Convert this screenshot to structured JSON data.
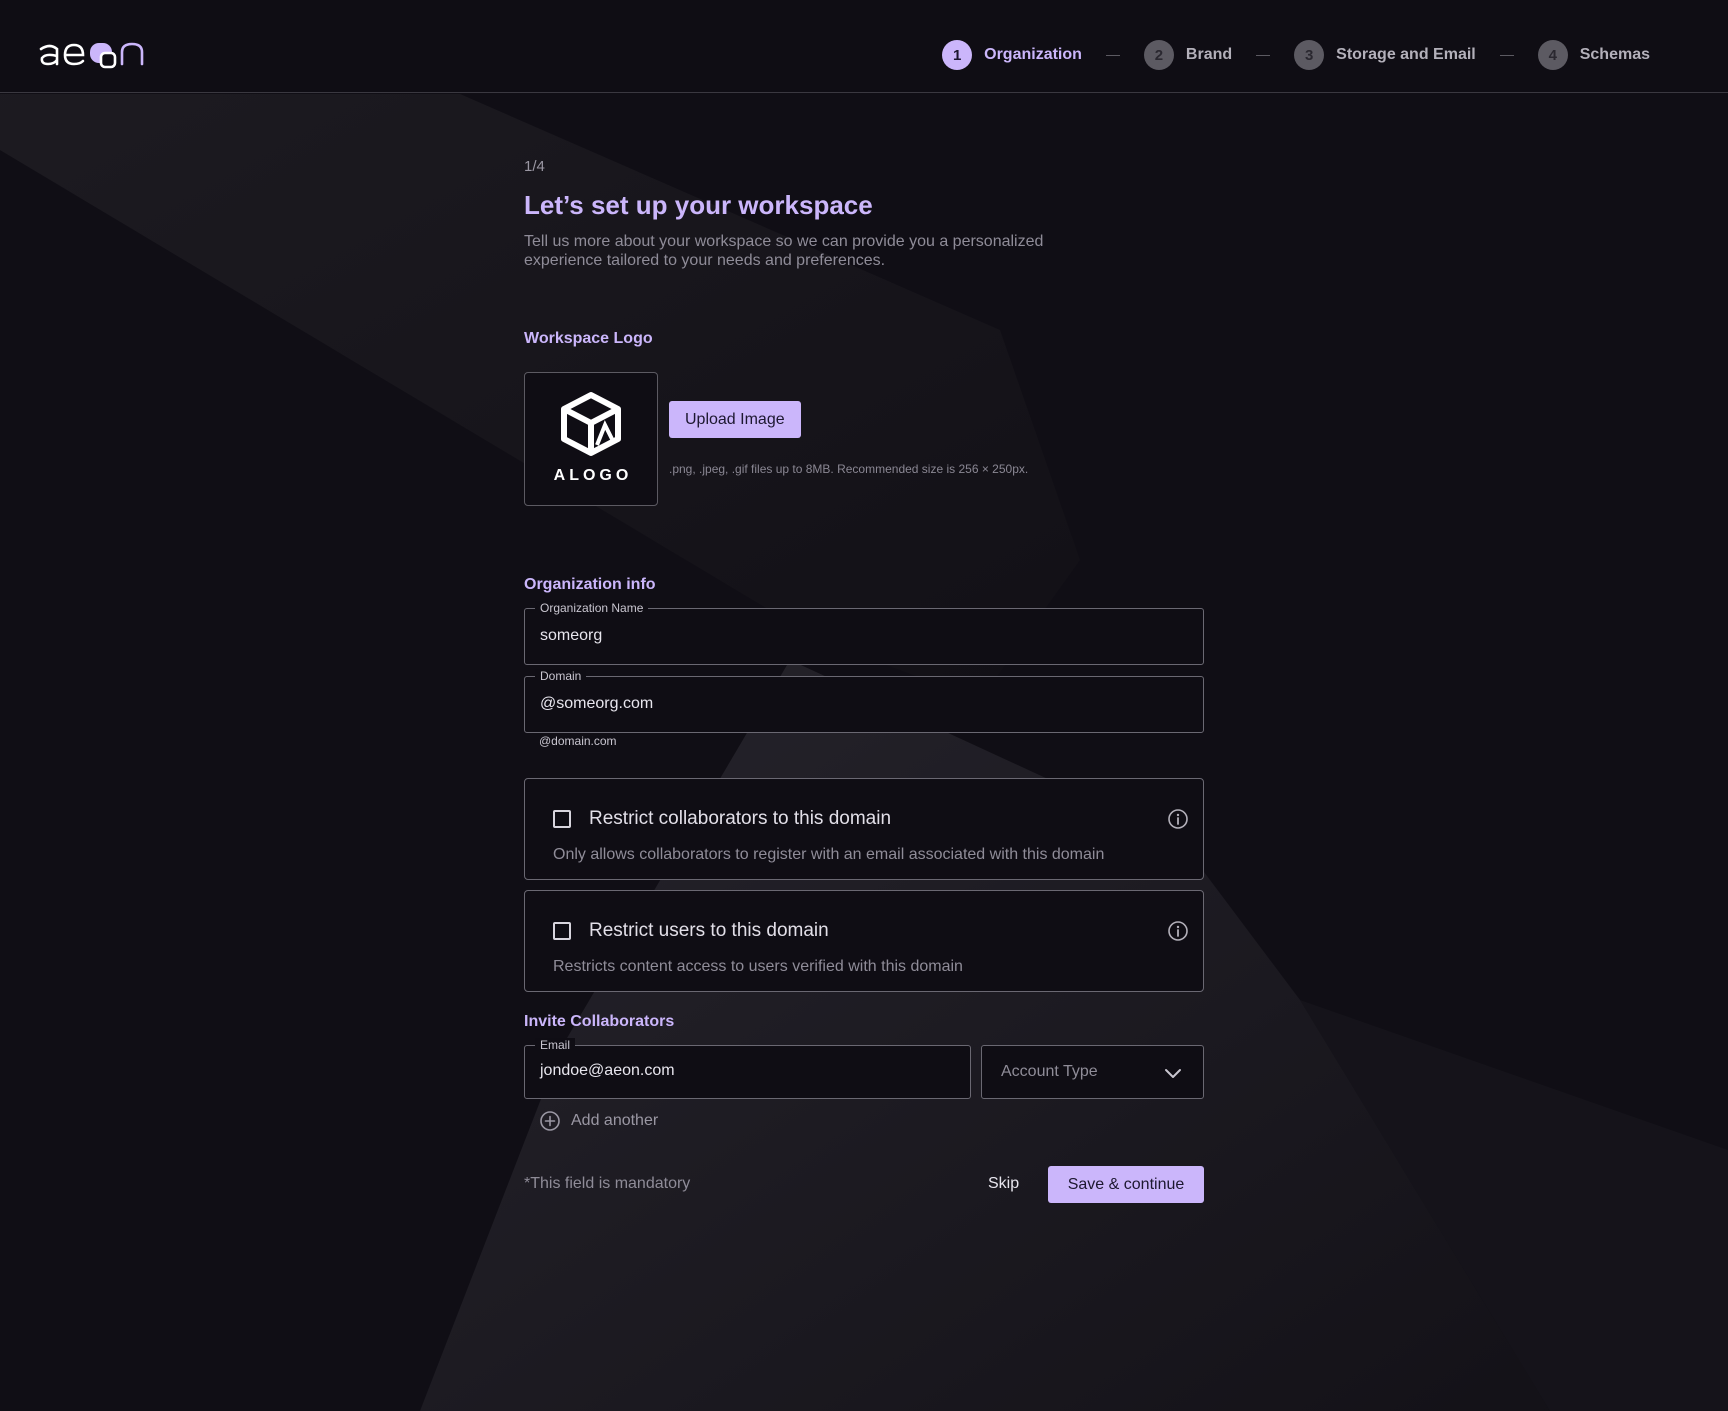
{
  "app": {
    "logo_text": "aeon"
  },
  "stepper": {
    "steps": [
      {
        "number": "1",
        "label": "Organization",
        "active": true
      },
      {
        "number": "2",
        "label": "Brand",
        "active": false
      },
      {
        "number": "3",
        "label": "Storage and Email",
        "active": false
      },
      {
        "number": "4",
        "label": "Schemas",
        "active": false
      }
    ]
  },
  "page": {
    "counter": "1/4",
    "title": "Let’s set up your workspace",
    "intro": "Tell us more about your workspace so we can provide you a personalized experience tailored to your needs and preferences."
  },
  "workspace_logo": {
    "section_label": "Workspace Logo",
    "logo_word": "ALOGO",
    "upload_label": "Upload Image",
    "hint": ".png, .jpeg, .gif files up to 8MB. Recommended size is 256 × 250px."
  },
  "organization": {
    "section_label": "Organization info",
    "name_legend": "Organization Name",
    "name_value": "someorg",
    "domain_legend": "Domain",
    "domain_value": "@someorg.com",
    "domain_helper": "@domain.com"
  },
  "restrictions": [
    {
      "title": "Restrict collaborators to this domain",
      "description": "Only allows collaborators to register with an email associated with this domain",
      "checked": false
    },
    {
      "title": "Restrict users to this domain",
      "description": "Restricts content access to users verified with this domain",
      "checked": false
    }
  ],
  "invite": {
    "section_label": "Invite Collaborators",
    "email_legend": "Email",
    "email_value": "jondoe@aeon.com",
    "account_type_placeholder": "Account Type",
    "add_another_label": "Add another"
  },
  "footer": {
    "mandatory_note": "*This field is mandatory",
    "skip_label": "Skip",
    "save_label": "Save & continue"
  },
  "colors": {
    "accent": "#cbb6fb",
    "background": "#100e15",
    "border": "#6a6872",
    "muted_text": "#8f8c98"
  },
  "icons": {
    "logo_mark": "aeon-logo",
    "info": "info-circle-icon",
    "chevron": "chevron-down-icon",
    "add": "plus-circle-icon",
    "workspace_logo": "cube-logo-icon"
  }
}
